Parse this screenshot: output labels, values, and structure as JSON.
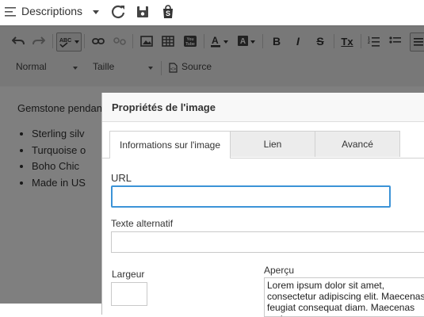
{
  "topbar": {
    "title": "Descriptions",
    "icons": [
      "menu-icon",
      "chevron-down-icon",
      "refresh-icon",
      "save-icon",
      "shopify-bag-icon"
    ]
  },
  "toolbar": {
    "format_label": "Normal",
    "size_label": "Taille",
    "source_label": "Source",
    "bold": "B",
    "italic": "I",
    "strike": "S",
    "clear_format": "Tx",
    "icons": [
      "undo-icon",
      "redo-icon",
      "spellcheck-icon",
      "link-icon",
      "unlink-icon",
      "image-icon",
      "table-icon",
      "youtube-icon",
      "text-color-icon",
      "background-color-icon",
      "bold-icon",
      "italic-icon",
      "strikethrough-icon",
      "remove-format-icon",
      "numbered-list-icon",
      "bulleted-list-icon",
      "align-icon",
      "source-icon"
    ]
  },
  "content": {
    "paragraph": "Gemstone pendan",
    "bullets": [
      "Sterling silv",
      "Turquoise o",
      "Boho Chic",
      "Made in US"
    ]
  },
  "dialog": {
    "title": "Propriétés de l'image",
    "tabs": [
      {
        "label": "Informations sur l'image"
      },
      {
        "label": "Lien"
      },
      {
        "label": "Avancé"
      }
    ],
    "url_label": "URL",
    "url_value": "",
    "alt_label": "Texte alternatif",
    "alt_value": "",
    "width_label": "Largeur",
    "preview_label": "Aperçu",
    "preview_text": "Lorem ipsum dolor sit amet, consectetur adipiscing elit. Maecenas feugiat consequat diam. Maecenas metus."
  },
  "colors": {
    "focus_border": "#3c93d7",
    "overlay": "rgba(0,0,0,0.5)"
  }
}
